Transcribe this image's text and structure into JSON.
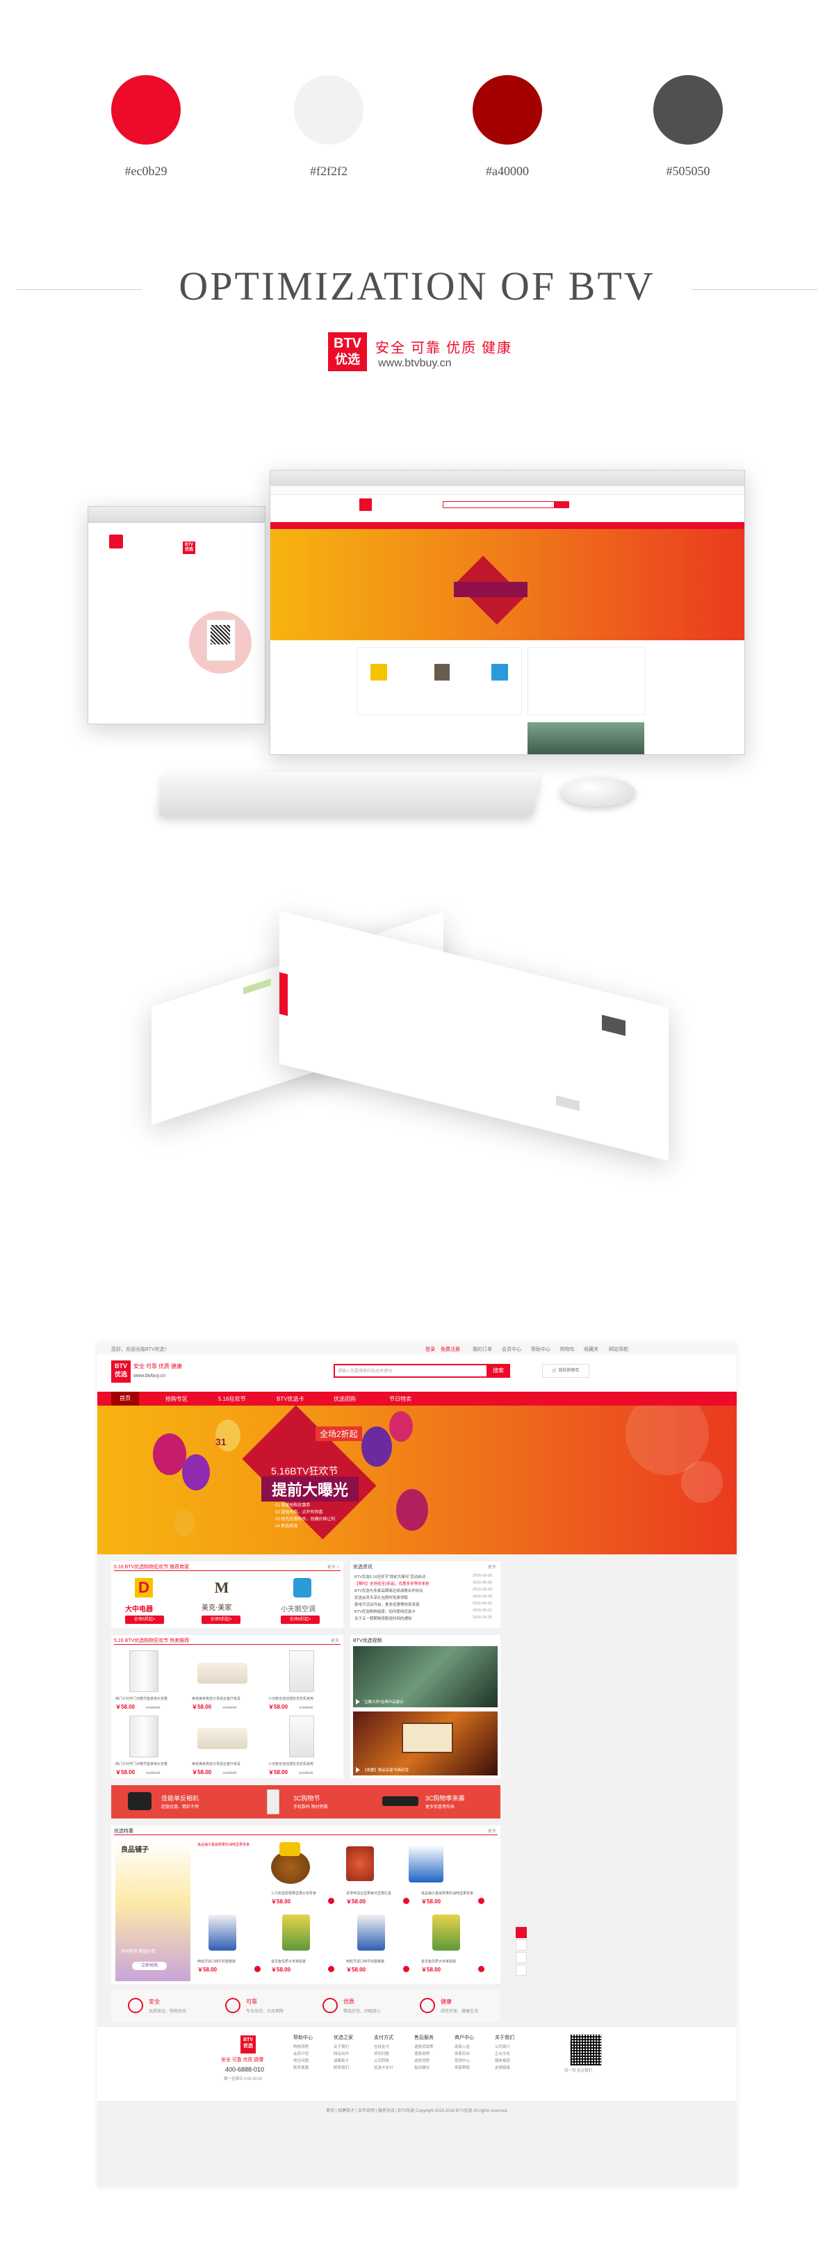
{
  "palette": [
    {
      "hex": "#ec0b29",
      "label": "#ec0b29"
    },
    {
      "hex": "#f2f2f2",
      "label": "#f2f2f2"
    },
    {
      "hex": "#a40000",
      "label": "#a40000"
    },
    {
      "hex": "#505050",
      "label": "#505050"
    }
  ],
  "title": "OPTIMIZATION OF BTV",
  "logo": {
    "top": "BTV",
    "bottom": "优选",
    "slogan": "安全 可靠 优质 健康",
    "url": "www.btvbuy.cn"
  },
  "site": {
    "topbar": {
      "left": "您好，欢迎光临BTV优选！",
      "links": [
        "登录",
        "免费注册",
        "我的订单",
        "会员中心",
        "帮助中心",
        "购物车",
        "收藏夹",
        "网站导航"
      ]
    },
    "search_placeholder": "请输入您要搜索的商品关键词",
    "search_button": "搜索",
    "cart_label": "我的购物车",
    "nav": [
      "首页",
      "抢购专区",
      "5.16狂欢节",
      "BTV优选卡",
      "优选团购",
      "节日特卖"
    ],
    "banner": {
      "tag": "31",
      "discount": "全场2折起",
      "headline_small": "5.16BTV狂欢节",
      "headline_big": "提前大曝光",
      "lines": [
        "01 限量抢购优惠券",
        "02 超值抢购，点开有惊喜",
        "03 抢先优惠秒杀，劲爆价格让利",
        "04 新品首发"
      ]
    },
    "brands_panel": {
      "title": "5.16 BTV优选购物狂欢节 推荐商家",
      "more": "更多 >",
      "brands": [
        {
          "name": "大中电器",
          "sub": "DAZHONG ELECTRONICS",
          "button": "全场5折起>"
        },
        {
          "name": "美克·美家",
          "sub": "Markor Furnishings",
          "button": "全场5折起>"
        },
        {
          "name": "小天鹅空调",
          "sub": "",
          "button": "全场6折起>"
        }
      ]
    },
    "news_panel": {
      "title": "优选资讯",
      "more": "更多",
      "items": [
        {
          "text": "BTV优选5.16狂欢节“提前大曝光”活动启动",
          "date": "2016-05-06"
        },
        {
          "text": "【限时】全场低至2折起，优惠多多等你来抢",
          "date": "2016-05-05"
        },
        {
          "text": "BTV优选与多家品牌商达成战略合作协议",
          "date": "2016-05-04"
        },
        {
          "text": "优选会员专享礼包限时免费领取",
          "date": "2016-05-03"
        },
        {
          "text": "家电节活动开启，更多优惠等你来发现",
          "date": "2016-05-02"
        },
        {
          "text": "BTV优选购物指南：如何使用优选卡",
          "date": "2016-05-01"
        },
        {
          "text": "关于五一假期物流配送时间的通知",
          "date": "2016-04-30"
        }
      ]
    },
    "hot_panel": {
      "title": "5.16 BTV优选购物狂欢节 热卖推荐",
      "more": "更多",
      "products": [
        {
          "name": "西门子对开门冰箱节能家用大容量",
          "price": "￥58.00",
          "old": "￥198.00"
        },
        {
          "name": "美克美家真皮沙发组合客厅家具",
          "price": "￥58.00",
          "old": "￥198.00"
        },
        {
          "name": "小天鹅全自动波轮洗衣机家用",
          "price": "￥58.00",
          "old": "￥198.00"
        },
        {
          "name": "西门子对开门冰箱节能家用大容量",
          "price": "￥58.00",
          "old": "￥198.00"
        },
        {
          "name": "美克美家真皮沙发组合客厅家具",
          "price": "￥58.00",
          "old": "￥198.00"
        },
        {
          "name": "小天鹅全自动波轮洗衣机家用",
          "price": "￥58.00",
          "old": "￥198.00"
        }
      ]
    },
    "video_panel": {
      "title": "BTV优选视频",
      "captions": [
        "“玉雕大师”经典作品展示",
        "【收藏】精品名家书画欣赏"
      ]
    },
    "promo_strip": [
      {
        "title": "佳能单反相机",
        "sub": "超值优惠，精彩不停"
      },
      {
        "title": "3C购物节",
        "sub": "手机数码 限时特惠"
      },
      {
        "title": "3C购物季来袭",
        "sub": "更多惊喜等你来"
      }
    ],
    "food_panel": {
      "title": "优选特惠",
      "more": "更多",
      "side_title": "良品铺子",
      "side_sub": "休闲零食 精选好货",
      "side_button": "立即抢购",
      "products": [
        {
          "name": "良品铺子夏威夷果奶油味坚果零食",
          "price": "￥58.00"
        },
        {
          "name": "三只松鼠碧根果坚果炒货零食",
          "price": "￥58.00"
        },
        {
          "name": "百草味混合坚果每日坚果礼盒",
          "price": "￥58.00"
        },
        {
          "name": "良品铺子夏威夷果奶油味坚果零食",
          "price": "￥58.00"
        },
        {
          "name": "西班牙进口纯牛奶整箱装",
          "price": "￥58.00"
        },
        {
          "name": "金龙鱼优质大米家庭装",
          "price": "￥58.00"
        },
        {
          "name": "西班牙进口纯牛奶整箱装",
          "price": "￥58.00"
        },
        {
          "name": "金龙鱼优质大米家庭装",
          "price": "￥58.00"
        }
      ]
    },
    "features": [
      {
        "title": "安全",
        "sub": "品质保证，购物无忧"
      },
      {
        "title": "可靠",
        "sub": "专业品控，正品保障"
      },
      {
        "title": "优质",
        "sub": "精选好货，闭眼放心"
      },
      {
        "title": "健康",
        "sub": "绿色环保，健康生活"
      }
    ],
    "footer": {
      "phone": "400-6888-010",
      "hours": "周一至周日 9:00-22:00",
      "columns": [
        {
          "title": "帮助中心",
          "items": [
            "购物流程",
            "会员介绍",
            "常见问题",
            "联系客服"
          ]
        },
        {
          "title": "优选之家",
          "items": [
            "关于我们",
            "网站合作",
            "诚聘英才",
            "联系我们"
          ]
        },
        {
          "title": "支付方式",
          "items": [
            "在线支付",
            "货到付款",
            "公司转账",
            "优选卡支付"
          ]
        },
        {
          "title": "售后服务",
          "items": [
            "退换货政策",
            "退款说明",
            "返修流程",
            "投诉建议"
          ]
        },
        {
          "title": "商户中心",
          "items": [
            "商家入驻",
            "商家后台",
            "营销中心",
            "商家帮助"
          ]
        },
        {
          "title": "关于我们",
          "items": [
            "公司简介",
            "企业文化",
            "媒体报道",
            "友情链接"
          ]
        }
      ],
      "qr_label": "扫一扫 关注我们"
    },
    "copyright": "首页 | 招聘英才 | 合作说明 | 服务协议 | BTV优选   Copyright 2015-2016 BTV优选 All rights reserved."
  }
}
